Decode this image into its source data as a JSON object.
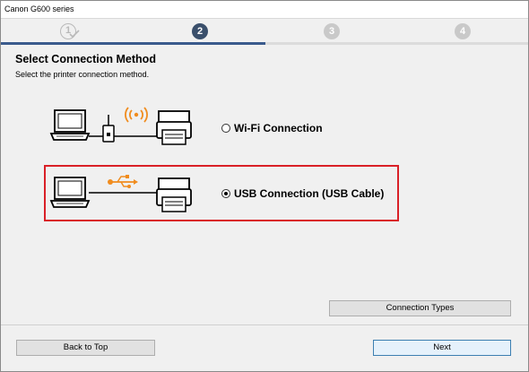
{
  "window": {
    "title": "Canon G600 series"
  },
  "steps": [
    {
      "number": "1",
      "state": "done"
    },
    {
      "number": "2",
      "state": "current"
    },
    {
      "number": "3",
      "state": "future"
    },
    {
      "number": "4",
      "state": "future"
    }
  ],
  "page": {
    "title": "Select Connection Method",
    "subtitle": "Select the printer connection method."
  },
  "options": [
    {
      "id": "wifi",
      "label": "Wi-Fi Connection",
      "selected": false,
      "icon": "wifi-router-icon"
    },
    {
      "id": "usb",
      "label": "USB Connection (USB Cable)",
      "selected": true,
      "icon": "usb-icon"
    }
  ],
  "buttons": {
    "connection_types": "Connection Types",
    "back_to_top": "Back to Top",
    "next": "Next"
  },
  "colors": {
    "accent": "#3a5a8c",
    "highlight": "#d92027",
    "wifi_orange": "#f08c1e",
    "step_current": "#3a4f6b",
    "step_future": "#c9c9c9"
  }
}
